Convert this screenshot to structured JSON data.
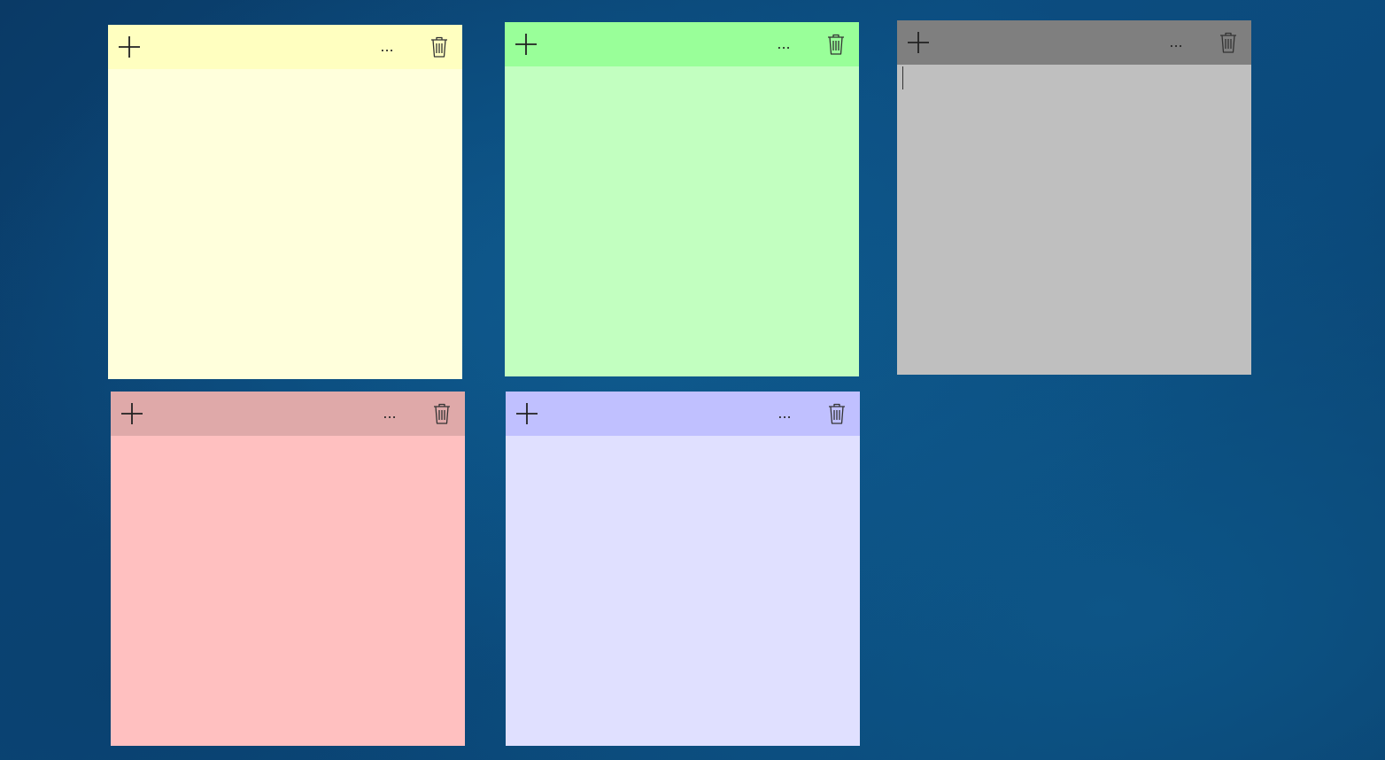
{
  "notes": [
    {
      "id": "yellow",
      "header_color": "#ffffc0",
      "body_color": "#ffffdc",
      "add_icon": "plus-icon",
      "menu_label": "...",
      "delete_icon": "trash-icon",
      "text": ""
    },
    {
      "id": "green",
      "header_color": "#99ff99",
      "body_color": "#c2ffc0",
      "add_icon": "plus-icon",
      "menu_label": "...",
      "delete_icon": "trash-icon",
      "text": ""
    },
    {
      "id": "gray",
      "header_color": "#7f7f7f",
      "body_color": "#bfbfbf",
      "add_icon": "plus-icon",
      "menu_label": "...",
      "delete_icon": "trash-icon",
      "text": "",
      "focused": true
    },
    {
      "id": "pink",
      "header_color": "#dfa9a9",
      "body_color": "#ffc0c0",
      "add_icon": "plus-icon",
      "menu_label": "...",
      "delete_icon": "trash-icon",
      "text": ""
    },
    {
      "id": "lavender",
      "header_color": "#c0c0ff",
      "body_color": "#e0e0ff",
      "add_icon": "plus-icon",
      "menu_label": "...",
      "delete_icon": "trash-icon",
      "text": ""
    }
  ]
}
